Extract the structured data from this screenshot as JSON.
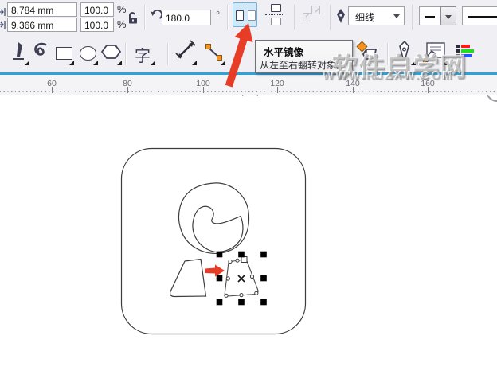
{
  "property_bar": {
    "size_width": "8.784 mm",
    "size_height": "9.366 mm",
    "scale_width": "100.0",
    "scale_height": "100.0",
    "percent_sign": "%",
    "rotation_angle": "180.0",
    "degree_sign": "°",
    "outline_width_value": "细线",
    "line_style_glyph": "—"
  },
  "toolbox": {
    "text_tool_glyph": "字"
  },
  "tooltip": {
    "title": "水平镜像",
    "description": "从左至右翻转对象。"
  },
  "ruler": {
    "ticks": [
      "60",
      "80",
      "100",
      "120",
      "140",
      "160"
    ]
  },
  "watermark": {
    "title": "软件自学网",
    "url": "WWW.RJZXW.COM"
  },
  "icons": {
    "object-size-icon": "arrow-to-bar",
    "lock-icon": "open-padlock",
    "rotate-ccw-icon": "counterclockwise-arrow",
    "mirror-horizontal-icon": "pages-flanking-vertical-dotted-line",
    "mirror-vertical-icon": "pages-flanking-horizontal-dotted-line",
    "scale-disabled-icon": "two-gray-squares-diagonal-arrows",
    "outline-pen-icon": "fountain-nib",
    "pen-tool-icon": "fountain-nib-dark",
    "freehand-tool-icon": "swirl-curve",
    "rectangle-tool-icon": "rectangle",
    "ellipse-tool-icon": "circle",
    "polygon-tool-icon": "hexagon",
    "dimension-tool-icon": "diagonal-double-arrow",
    "connector-tool-icon": "orange-squares-linked",
    "fill-tool-icon": "paint-bucket-orange-diamond",
    "smart-drawing-icon": "pen-over-document",
    "color-styles-icon": "red-green-blue-bars",
    "dropdown-caret-icon": "down-triangle",
    "selection-handle": "black-square",
    "object-center-icon": "x-marker",
    "annotation-arrow": "red-arrow"
  },
  "colors": {
    "toolbar_bg": "#f0eff4",
    "highlight_bg": "#cfe9f8",
    "highlight_border": "#6fb1dc",
    "ruler_guide_blue": "#2da3de",
    "tool_orange": "#f6921e",
    "annotation_red": "#e73c25",
    "handle_black": "#000000"
  }
}
